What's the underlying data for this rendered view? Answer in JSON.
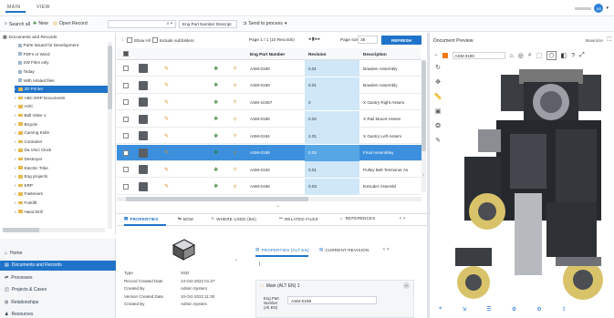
{
  "top_tabs": [
    "MAIN",
    "VIEW"
  ],
  "user_avatar": "AS",
  "toolbar": {
    "search_all": "Search all",
    "new": "New",
    "open_record": "Open Record",
    "search_placeholder": "",
    "search_mode": "Eng Part Number Descript",
    "send": "Send to process"
  },
  "tree": {
    "header": "Documents and Records",
    "items": [
      {
        "label": "Parts Issued for Development",
        "type": "doc"
      },
      {
        "label": "PDFs or Word",
        "type": "doc"
      },
      {
        "label": "SW Files only",
        "type": "doc"
      },
      {
        "label": "Today",
        "type": "doc"
      },
      {
        "label": "With related files",
        "type": "doc"
      },
      {
        "label": "3D Printer",
        "type": "folder",
        "selected": true
      },
      {
        "label": "ABC ERP Documents",
        "type": "folder"
      },
      {
        "label": "AOC",
        "type": "folder"
      },
      {
        "label": "Ball Valve 1",
        "type": "folder"
      },
      {
        "label": "Bicycle",
        "type": "folder"
      },
      {
        "label": "Carving Knife",
        "type": "folder"
      },
      {
        "label": "Container",
        "type": "folder"
      },
      {
        "label": "Da Vinci Clock",
        "type": "folder"
      },
      {
        "label": "Destroyer",
        "type": "folder"
      },
      {
        "label": "Electric Trike",
        "type": "folder"
      },
      {
        "label": "Eng projects",
        "type": "folder"
      },
      {
        "label": "ERP",
        "type": "folder"
      },
      {
        "label": "Fasteners",
        "type": "folder"
      },
      {
        "label": "Forklift",
        "type": "folder"
      },
      {
        "label": "Hand Drill",
        "type": "folder"
      }
    ]
  },
  "nav": [
    {
      "label": "Home",
      "icon": "home-icon"
    },
    {
      "label": "Documents and Records",
      "icon": "documents-icon",
      "selected": true
    },
    {
      "label": "Processes",
      "icon": "processes-icon"
    },
    {
      "label": "Projects & Cases",
      "icon": "projects-icon"
    },
    {
      "label": "Relationships",
      "icon": "relationships-icon"
    },
    {
      "label": "Resources",
      "icon": "resources-icon"
    }
  ],
  "grid": {
    "show_all": "Show All",
    "include_sub": "Include subfolders",
    "paging": "Page 1 / 1 (10 Records)",
    "page_size_label": "Page size",
    "page_size": "35",
    "refresh": "REFRESH",
    "columns": [
      "Eng Part Number",
      "Revision",
      "Description"
    ],
    "rows": [
      {
        "part": "ASM-0190",
        "rev": "0.01",
        "desc": "Bowden Assembly"
      },
      {
        "part": "ASM-0190",
        "rev": "0.01",
        "desc": "Bowden Assembly"
      },
      {
        "part": "ASM-10467",
        "rev": "0",
        "desc": "X Gantry Right Assem"
      },
      {
        "part": "ASM-0196",
        "rev": "0.02",
        "desc": "X Rail Mount Assem"
      },
      {
        "part": "ASM-0194",
        "rev": "2.01",
        "desc": "X Gantry Left Assem"
      },
      {
        "part": "ASM-0199",
        "rev": "0.02",
        "desc": "Final Assembley",
        "selected": true
      },
      {
        "part": "ASM-0193",
        "rev": "0.01",
        "desc": "Pulley Belt Tensioner As"
      },
      {
        "part": "ASM-0198",
        "rev": "0.03",
        "desc": "Extruder Assembl"
      }
    ]
  },
  "bottom_tabs": [
    "PROPERTIES",
    "BOM",
    "WHERE USED (BS)",
    "RELATED FILES",
    "REFERENCES"
  ],
  "props": {
    "labels": [
      "Type",
      "Record Created Date",
      "Created By",
      "Version Created Date",
      "Created By"
    ],
    "values": [
      "SSD",
      "14-Oct-2022 01:27",
      "Admin System",
      "10-Oct-2022 11:30",
      "Admin System"
    ],
    "tabs": [
      "PROPERTIES (ALT EN)",
      "CURRENT REVISION"
    ],
    "section": "Main (ALT EN) 1",
    "field_label": "Eng Part Number (Alt EN)",
    "field_value": "ASM-0199"
  },
  "preview": {
    "title": "Document Preview",
    "maximize": "Maximize",
    "file": "ASM-0199"
  }
}
